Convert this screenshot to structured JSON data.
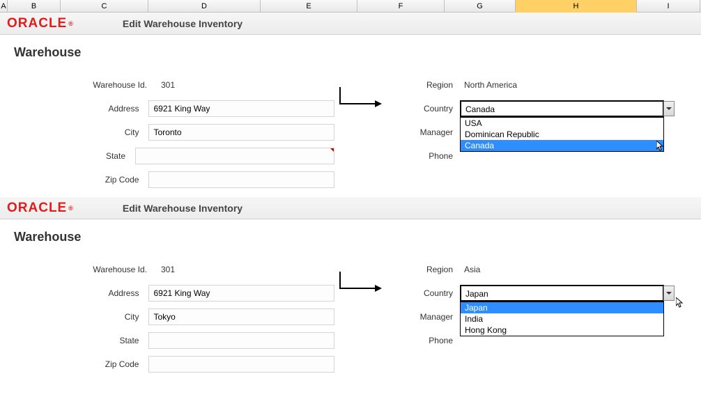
{
  "columns": [
    "A",
    "B",
    "C",
    "D",
    "E",
    "F",
    "G",
    "H",
    "I"
  ],
  "selected_column": "H",
  "brand": "ORACLE",
  "forms": [
    {
      "title": "Edit Warehouse Inventory",
      "section": "Warehouse",
      "left": {
        "warehouse_id": {
          "label": "Warehouse Id.",
          "value": "301"
        },
        "address": {
          "label": "Address",
          "value": "6921 King Way"
        },
        "city": {
          "label": "City",
          "value": "Toronto"
        },
        "state": {
          "label": "State",
          "value": ""
        },
        "zipcode": {
          "label": "Zip Code",
          "value": ""
        }
      },
      "right": {
        "region": {
          "label": "Region",
          "value": "North America"
        },
        "country": {
          "label": "Country",
          "selected": "Canada",
          "options": [
            "USA",
            "Dominican Republic",
            "Canada"
          ],
          "highlighted_index": 2
        },
        "manager": {
          "label": "Manager",
          "value": ""
        },
        "phone": {
          "label": "Phone",
          "value": ""
        }
      }
    },
    {
      "title": "Edit Warehouse Inventory",
      "section": "Warehouse",
      "left": {
        "warehouse_id": {
          "label": "Warehouse Id.",
          "value": "301"
        },
        "address": {
          "label": "Address",
          "value": "6921 King Way"
        },
        "city": {
          "label": "City",
          "value": "Tokyo"
        },
        "state": {
          "label": "State",
          "value": ""
        },
        "zipcode": {
          "label": "Zip Code",
          "value": ""
        }
      },
      "right": {
        "region": {
          "label": "Region",
          "value": "Asia"
        },
        "country": {
          "label": "Country",
          "selected": "Japan",
          "options": [
            "Japan",
            "India",
            "Hong Kong"
          ],
          "highlighted_index": 0
        },
        "manager": {
          "label": "Manager",
          "value": ""
        },
        "phone": {
          "label": "Phone",
          "value": ""
        }
      }
    }
  ]
}
